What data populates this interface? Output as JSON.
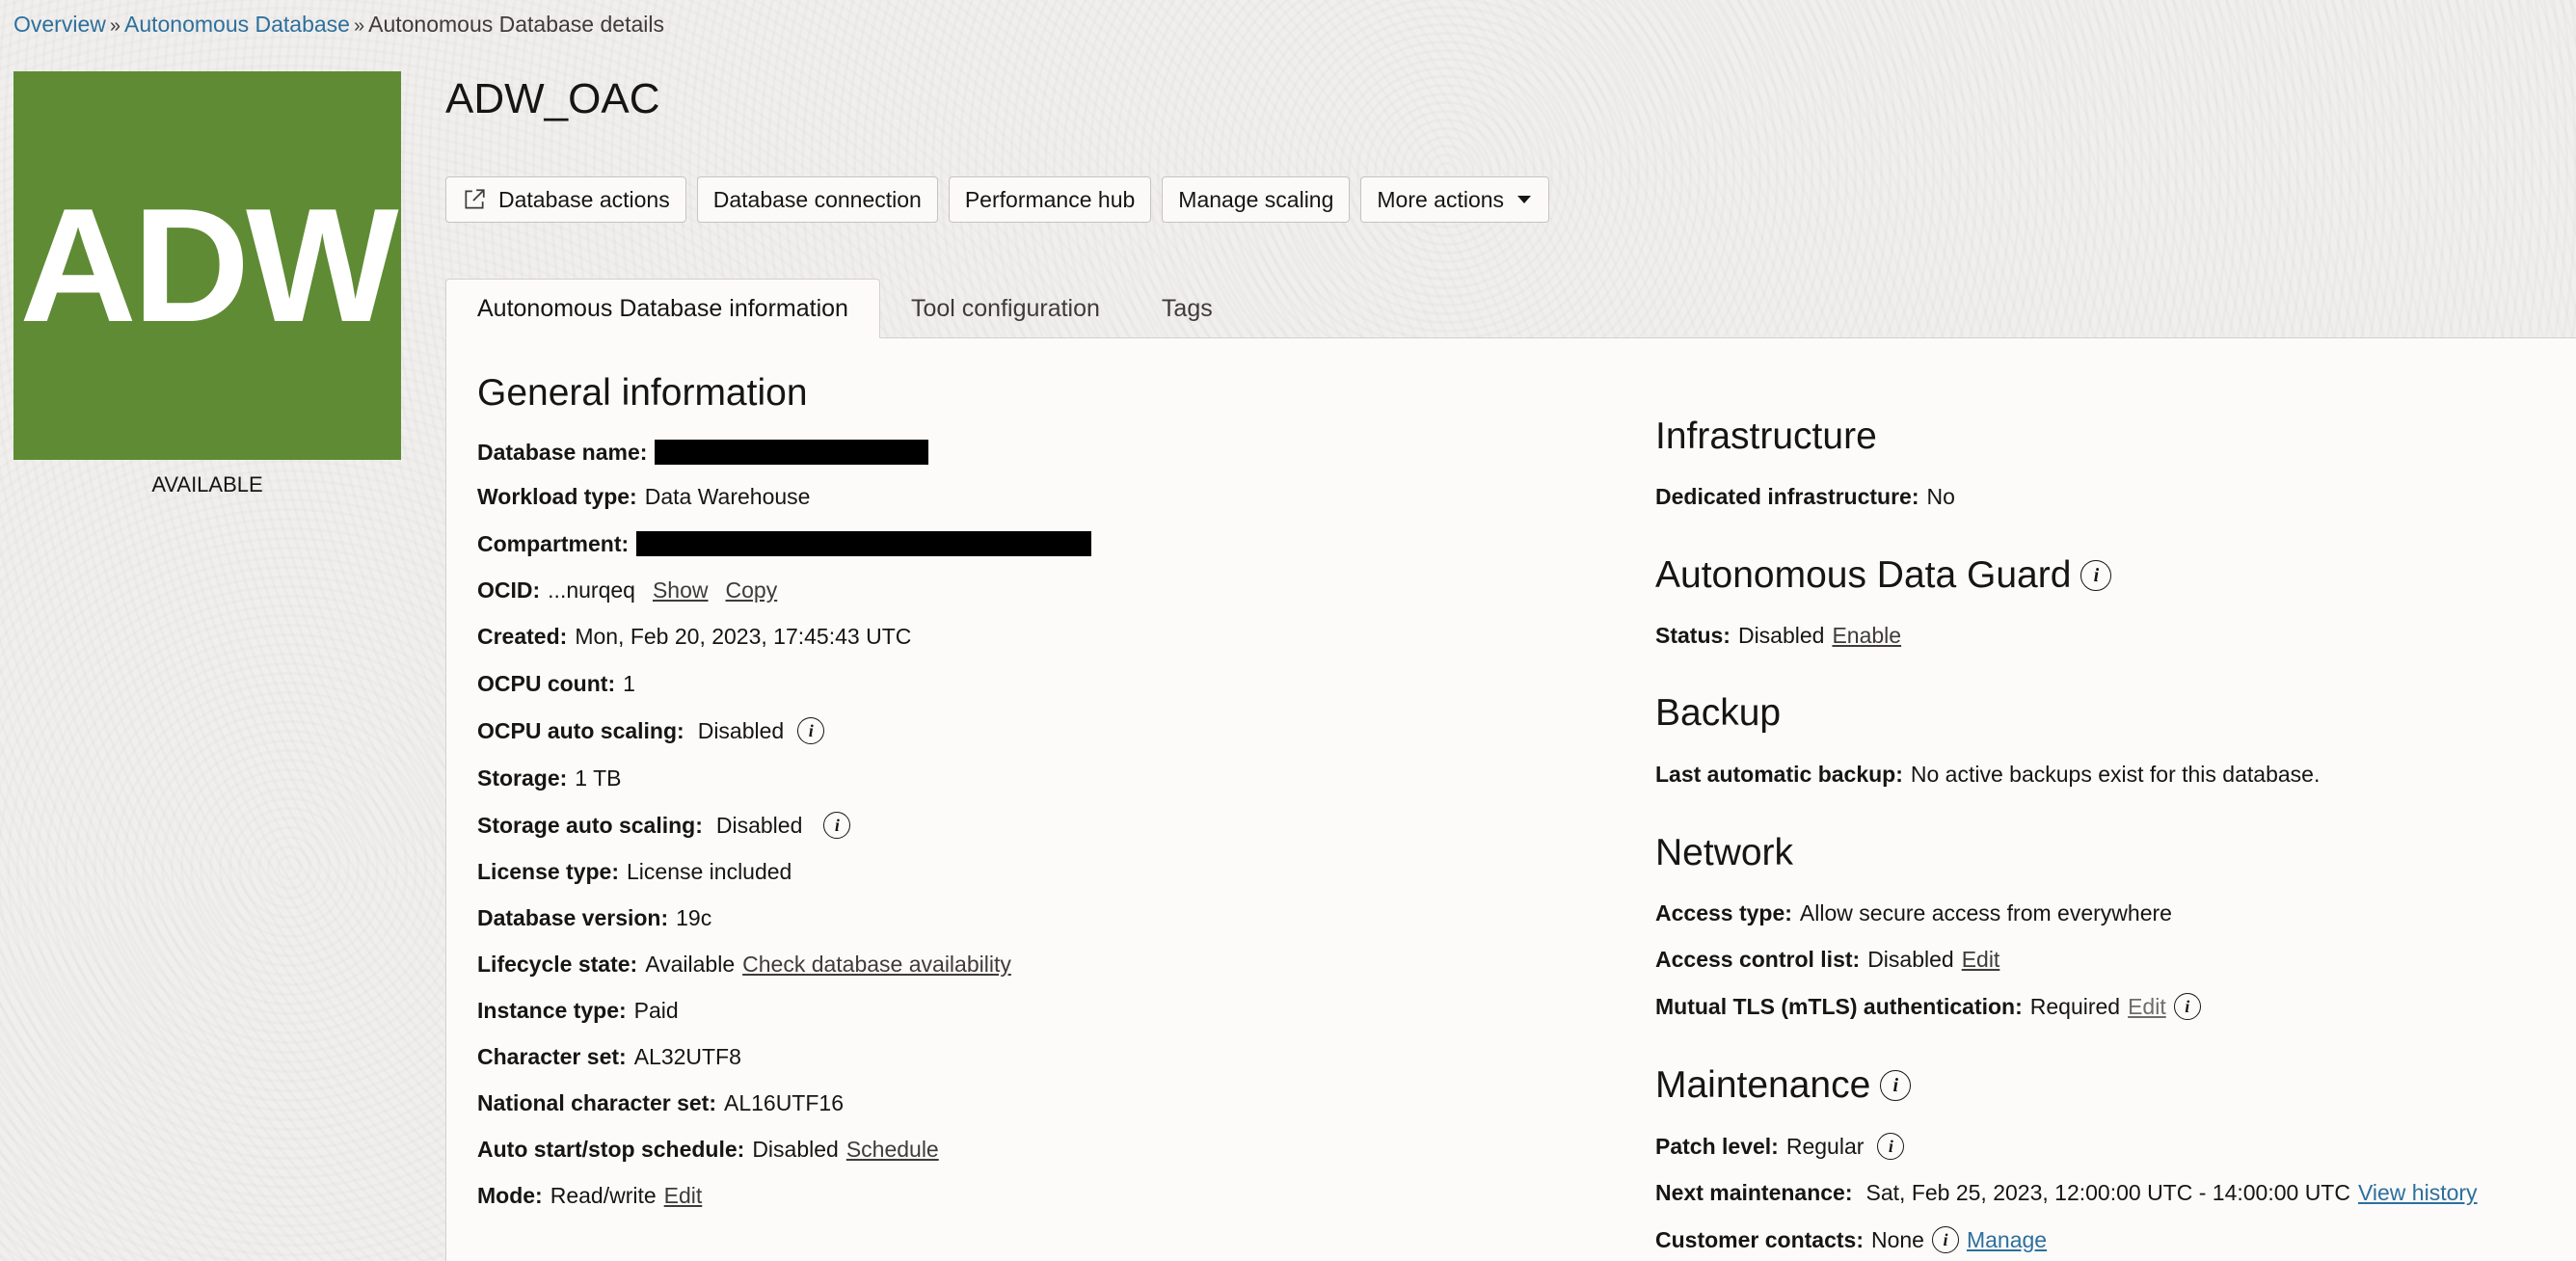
{
  "breadcrumb": {
    "items": [
      "Overview",
      "Autonomous Database",
      "Autonomous Database details"
    ],
    "separator": "»"
  },
  "logo": {
    "text": "ADW",
    "status": "AVAILABLE",
    "color": "#5e8b34"
  },
  "title": "ADW_OAC",
  "actions": {
    "database_actions": "Database actions",
    "database_connection": "Database connection",
    "performance_hub": "Performance hub",
    "manage_scaling": "Manage scaling",
    "more_actions": "More actions"
  },
  "tabs": [
    "Autonomous Database information",
    "Tool configuration",
    "Tags"
  ],
  "general": {
    "heading": "General information",
    "db_name_label": "Database name:",
    "workload_label": "Workload type:",
    "workload_value": "Data Warehouse",
    "compartment_label": "Compartment:",
    "ocid_label": "OCID:",
    "ocid_value": "...nurqeq",
    "ocid_show": "Show",
    "ocid_copy": "Copy",
    "created_label": "Created:",
    "created_value": "Mon, Feb 20, 2023, 17:45:43 UTC",
    "ocpu_label": "OCPU count:",
    "ocpu_value": "1",
    "ocpu_auto_label": "OCPU auto scaling:",
    "ocpu_auto_value": "Disabled",
    "storage_label": "Storage:",
    "storage_value": "1 TB",
    "storage_auto_label": "Storage auto scaling:",
    "storage_auto_value": "Disabled",
    "license_label": "License type:",
    "license_value": "License included",
    "version_label": "Database version:",
    "version_value": "19c",
    "lifecycle_label": "Lifecycle state:",
    "lifecycle_value": "Available",
    "lifecycle_link": "Check database availability",
    "instance_label": "Instance type:",
    "instance_value": "Paid",
    "charset_label": "Character set:",
    "charset_value": "AL32UTF8",
    "ncharset_label": "National character set:",
    "ncharset_value": "AL16UTF16",
    "schedule_label": "Auto start/stop schedule:",
    "schedule_value": "Disabled",
    "schedule_link": "Schedule",
    "mode_label": "Mode:",
    "mode_value": "Read/write",
    "mode_link": "Edit"
  },
  "infrastructure": {
    "heading": "Infrastructure",
    "dedicated_label": "Dedicated infrastructure:",
    "dedicated_value": "No"
  },
  "data_guard": {
    "heading": "Autonomous Data Guard",
    "status_label": "Status:",
    "status_value": "Disabled",
    "enable_link": "Enable"
  },
  "backup": {
    "heading": "Backup",
    "last_label": "Last automatic backup:",
    "last_value": "No active backups exist for this database."
  },
  "network": {
    "heading": "Network",
    "access_type_label": "Access type:",
    "access_type_value": "Allow secure access from everywhere",
    "acl_label": "Access control list:",
    "acl_value": "Disabled",
    "acl_link": "Edit",
    "mtls_label": "Mutual TLS (mTLS) authentication:",
    "mtls_value": "Required",
    "mtls_link": "Edit"
  },
  "maintenance": {
    "heading": "Maintenance",
    "patch_label": "Patch level:",
    "patch_value": "Regular",
    "next_label": "Next maintenance:",
    "next_value": "Sat, Feb 25, 2023, 12:00:00 UTC - 14:00:00 UTC",
    "history_link": "View history",
    "contacts_label": "Customer contacts:",
    "contacts_value": "None",
    "contacts_link": "Manage"
  },
  "icons": [
    "external-link-icon",
    "caret-down-icon",
    "info-icon"
  ]
}
